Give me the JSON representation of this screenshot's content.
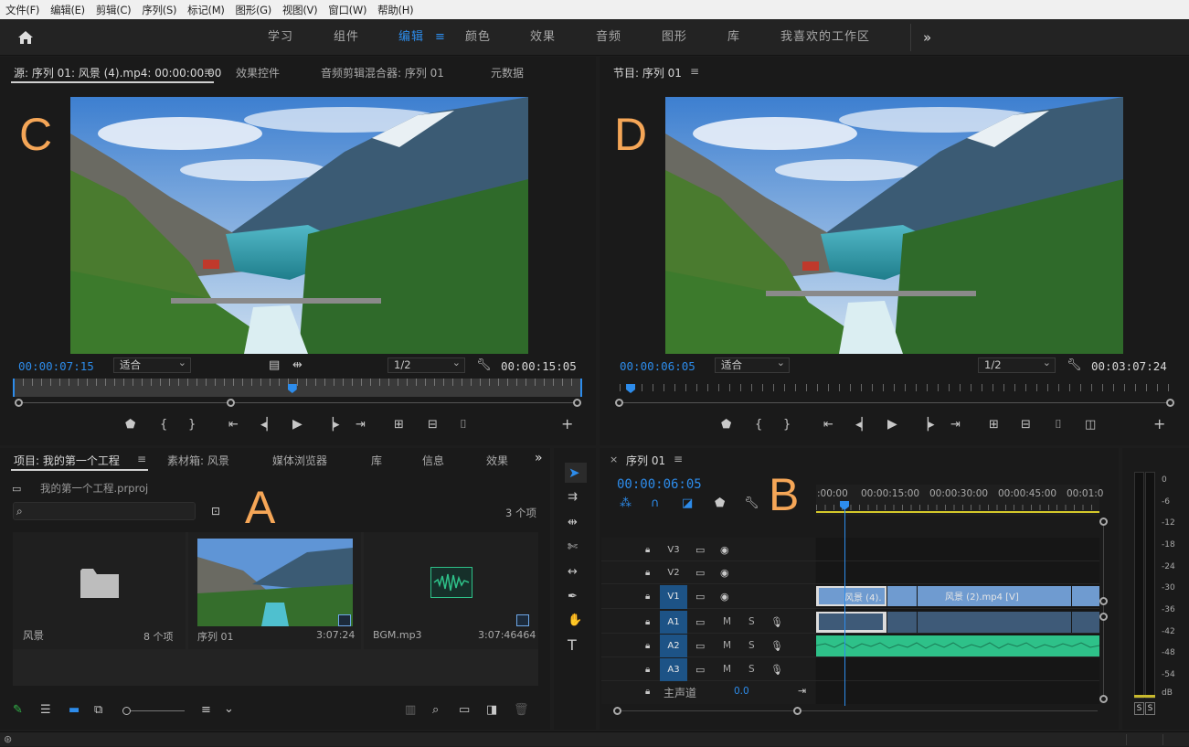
{
  "menu": [
    "文件(F)",
    "编辑(E)",
    "剪辑(C)",
    "序列(S)",
    "标记(M)",
    "图形(G)",
    "视图(V)",
    "窗口(W)",
    "帮助(H)"
  ],
  "workspaces": {
    "items": [
      "学习",
      "组件",
      "编辑",
      "颜色",
      "效果",
      "音频",
      "图形",
      "库",
      "我喜欢的工作区"
    ],
    "active": "编辑",
    "more": "»"
  },
  "source": {
    "tabs": [
      "源: 序列 01: 风景 (4).mp4: 00:00:00:00",
      "效果控件",
      "音频剪辑混合器: 序列 01",
      "元数据"
    ],
    "tab_menu": "≡",
    "timecode": "00:00:07:15",
    "fit": "适合",
    "resolution": "1/2",
    "duration": "00:00:15:05",
    "marker_letter": "C",
    "playhead_fraction": 0.49
  },
  "program": {
    "title": "节目: 序列 01",
    "tab_menu": "≡",
    "timecode": "00:00:06:05",
    "fit": "适合",
    "resolution": "1/2",
    "duration": "00:03:07:24",
    "marker_letter": "D",
    "playhead_fraction": 0.02
  },
  "project": {
    "tabs": [
      "项目: 我的第一个工程",
      "素材箱: 风景",
      "媒体浏览器",
      "库",
      "信息",
      "效果"
    ],
    "tab_menu": "≡",
    "more": "»",
    "file": "我的第一个工程.prproj",
    "count": "3 个项",
    "search_placeholder": "",
    "marker_letter": "A",
    "items": [
      {
        "name": "风景",
        "meta": "8 个项",
        "kind": "folder"
      },
      {
        "name": "序列 01",
        "meta": "3:07:24",
        "kind": "sequence"
      },
      {
        "name": "BGM.mp3",
        "meta": "3:07:46464",
        "kind": "audio"
      }
    ]
  },
  "timeline": {
    "close": "×",
    "title": "序列 01",
    "tab_menu": "≡",
    "timecode": "00:00:06:05",
    "marker_letter": "B",
    "ruler": [
      ":00:00",
      "00:00:15:00",
      "00:00:30:00",
      "00:00:45:00",
      "00:01:0"
    ],
    "video_tracks": [
      "V3",
      "V2",
      "V1"
    ],
    "audio_tracks": [
      "A1",
      "A2",
      "A3"
    ],
    "master_label": "主声道",
    "master_value": "0.0",
    "track_m": "M",
    "track_s": "S",
    "clips": {
      "v1a": "风景 (4).",
      "v1b": "风景 (2).mp4 [V]"
    },
    "playhead_seconds": 6.2
  },
  "meter": {
    "scale": [
      "0",
      "-6",
      "-12",
      "-18",
      "-24",
      "-30",
      "-36",
      "-42",
      "-48",
      "-54",
      "dB"
    ],
    "solo": [
      "S",
      "S"
    ]
  },
  "colors": {
    "accent": "#2d8ceb",
    "letters": "#f5a657",
    "clip_video": "#6f9bd0",
    "clip_audio": "#2ec189"
  }
}
